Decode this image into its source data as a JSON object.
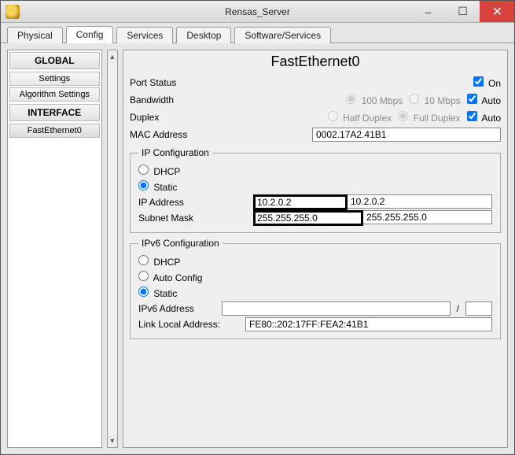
{
  "window": {
    "title": "Rensas_Server"
  },
  "tabs": [
    "Physical",
    "Config",
    "Services",
    "Desktop",
    "Software/Services"
  ],
  "active_tab": "Config",
  "sidebar": {
    "groups": [
      {
        "header": "GLOBAL",
        "items": [
          "Settings",
          "Algorithm Settings"
        ]
      },
      {
        "header": "INTERFACE",
        "items": [
          "FastEthernet0"
        ]
      }
    ],
    "selected": "FastEthernet0"
  },
  "panel": {
    "heading": "FastEthernet0",
    "port_status": {
      "label": "Port Status",
      "on_label": "On",
      "checked": true
    },
    "bandwidth": {
      "label": "Bandwidth",
      "opt100_label": "100 Mbps",
      "opt100_checked": true,
      "opt10_label": "10 Mbps",
      "opt10_checked": false,
      "auto_label": "Auto",
      "auto_checked": true
    },
    "duplex": {
      "label": "Duplex",
      "half_label": "Half Duplex",
      "half_checked": false,
      "full_label": "Full Duplex",
      "full_checked": true,
      "auto_label": "Auto",
      "auto_checked": true
    },
    "mac": {
      "label": "MAC Address",
      "value": "0002.17A2.41B1"
    },
    "ipcfg": {
      "legend": "IP Configuration",
      "dhcp_label": "DHCP",
      "static_label": "Static",
      "mode": "Static",
      "ip_label": "IP Address",
      "ip_value": "10.2.0.2",
      "mask_label": "Subnet Mask",
      "mask_value": "255.255.255.0"
    },
    "ipv6cfg": {
      "legend": "IPv6 Configuration",
      "dhcp_label": "DHCP",
      "auto_label": "Auto Config",
      "static_label": "Static",
      "mode": "Static",
      "addr_label": "IPv6 Address",
      "addr_value": "",
      "prefix_value": "",
      "ll_label": "Link Local Address:",
      "ll_value": "FE80::202:17FF:FEA2:41B1"
    }
  }
}
